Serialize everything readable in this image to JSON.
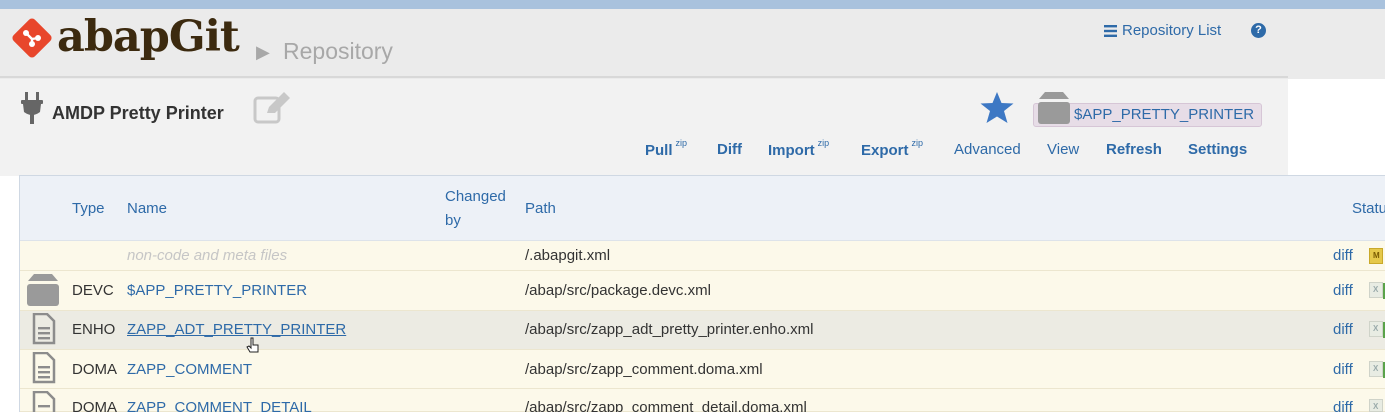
{
  "app": {
    "logo": "abapGit",
    "breadcrumb": "Repository"
  },
  "header": {
    "repo_list_label": "Repository List",
    "help_label": "?"
  },
  "repo": {
    "name": "AMDP Pretty Printer",
    "package": "$APP_PRETTY_PRINTER"
  },
  "menu": {
    "pull": "Pull",
    "pull_sup": "zip",
    "diff": "Diff",
    "import": "Import",
    "import_sup": "zip",
    "export": "Export",
    "export_sup": "zip",
    "advanced": "Advanced",
    "view": "View",
    "refresh": "Refresh",
    "settings": "Settings"
  },
  "table": {
    "headers": {
      "type": "Type",
      "name": "Name",
      "changed_by_1": "Changed",
      "changed_by_2": "by",
      "path": "Path",
      "status": "Status"
    },
    "rows": [
      {
        "icon": "",
        "type": "",
        "name": "non-code and meta files",
        "path": "/.abapgit.xml",
        "diff": "diff",
        "status": "M"
      },
      {
        "icon": "package-icon",
        "type": "DEVC",
        "name": "$APP_PRETTY_PRINTER",
        "path": "/abap/src/package.devc.xml",
        "diff": "diff",
        "status": "X"
      },
      {
        "icon": "file-icon",
        "type": "ENHO",
        "name": "ZAPP_ADT_PRETTY_PRINTER",
        "path": "/abap/src/zapp_adt_pretty_printer.enho.xml",
        "diff": "diff",
        "status": "X"
      },
      {
        "icon": "file-icon",
        "type": "DOMA",
        "name": "ZAPP_COMMENT",
        "path": "/abap/src/zapp_comment.doma.xml",
        "diff": "diff",
        "status": "X"
      },
      {
        "icon": "file-icon",
        "type": "DOMA",
        "name": "ZAPP_COMMENT_DETAIL",
        "path": "/abap/src/zapp_comment_detail.doma.xml",
        "diff": "diff",
        "status": "X"
      }
    ]
  },
  "colors": {
    "link": "#2e6aa8",
    "brand": "#e8462b",
    "row_bg": "#fcf9ea",
    "row_highlight": "#ecebe3"
  }
}
